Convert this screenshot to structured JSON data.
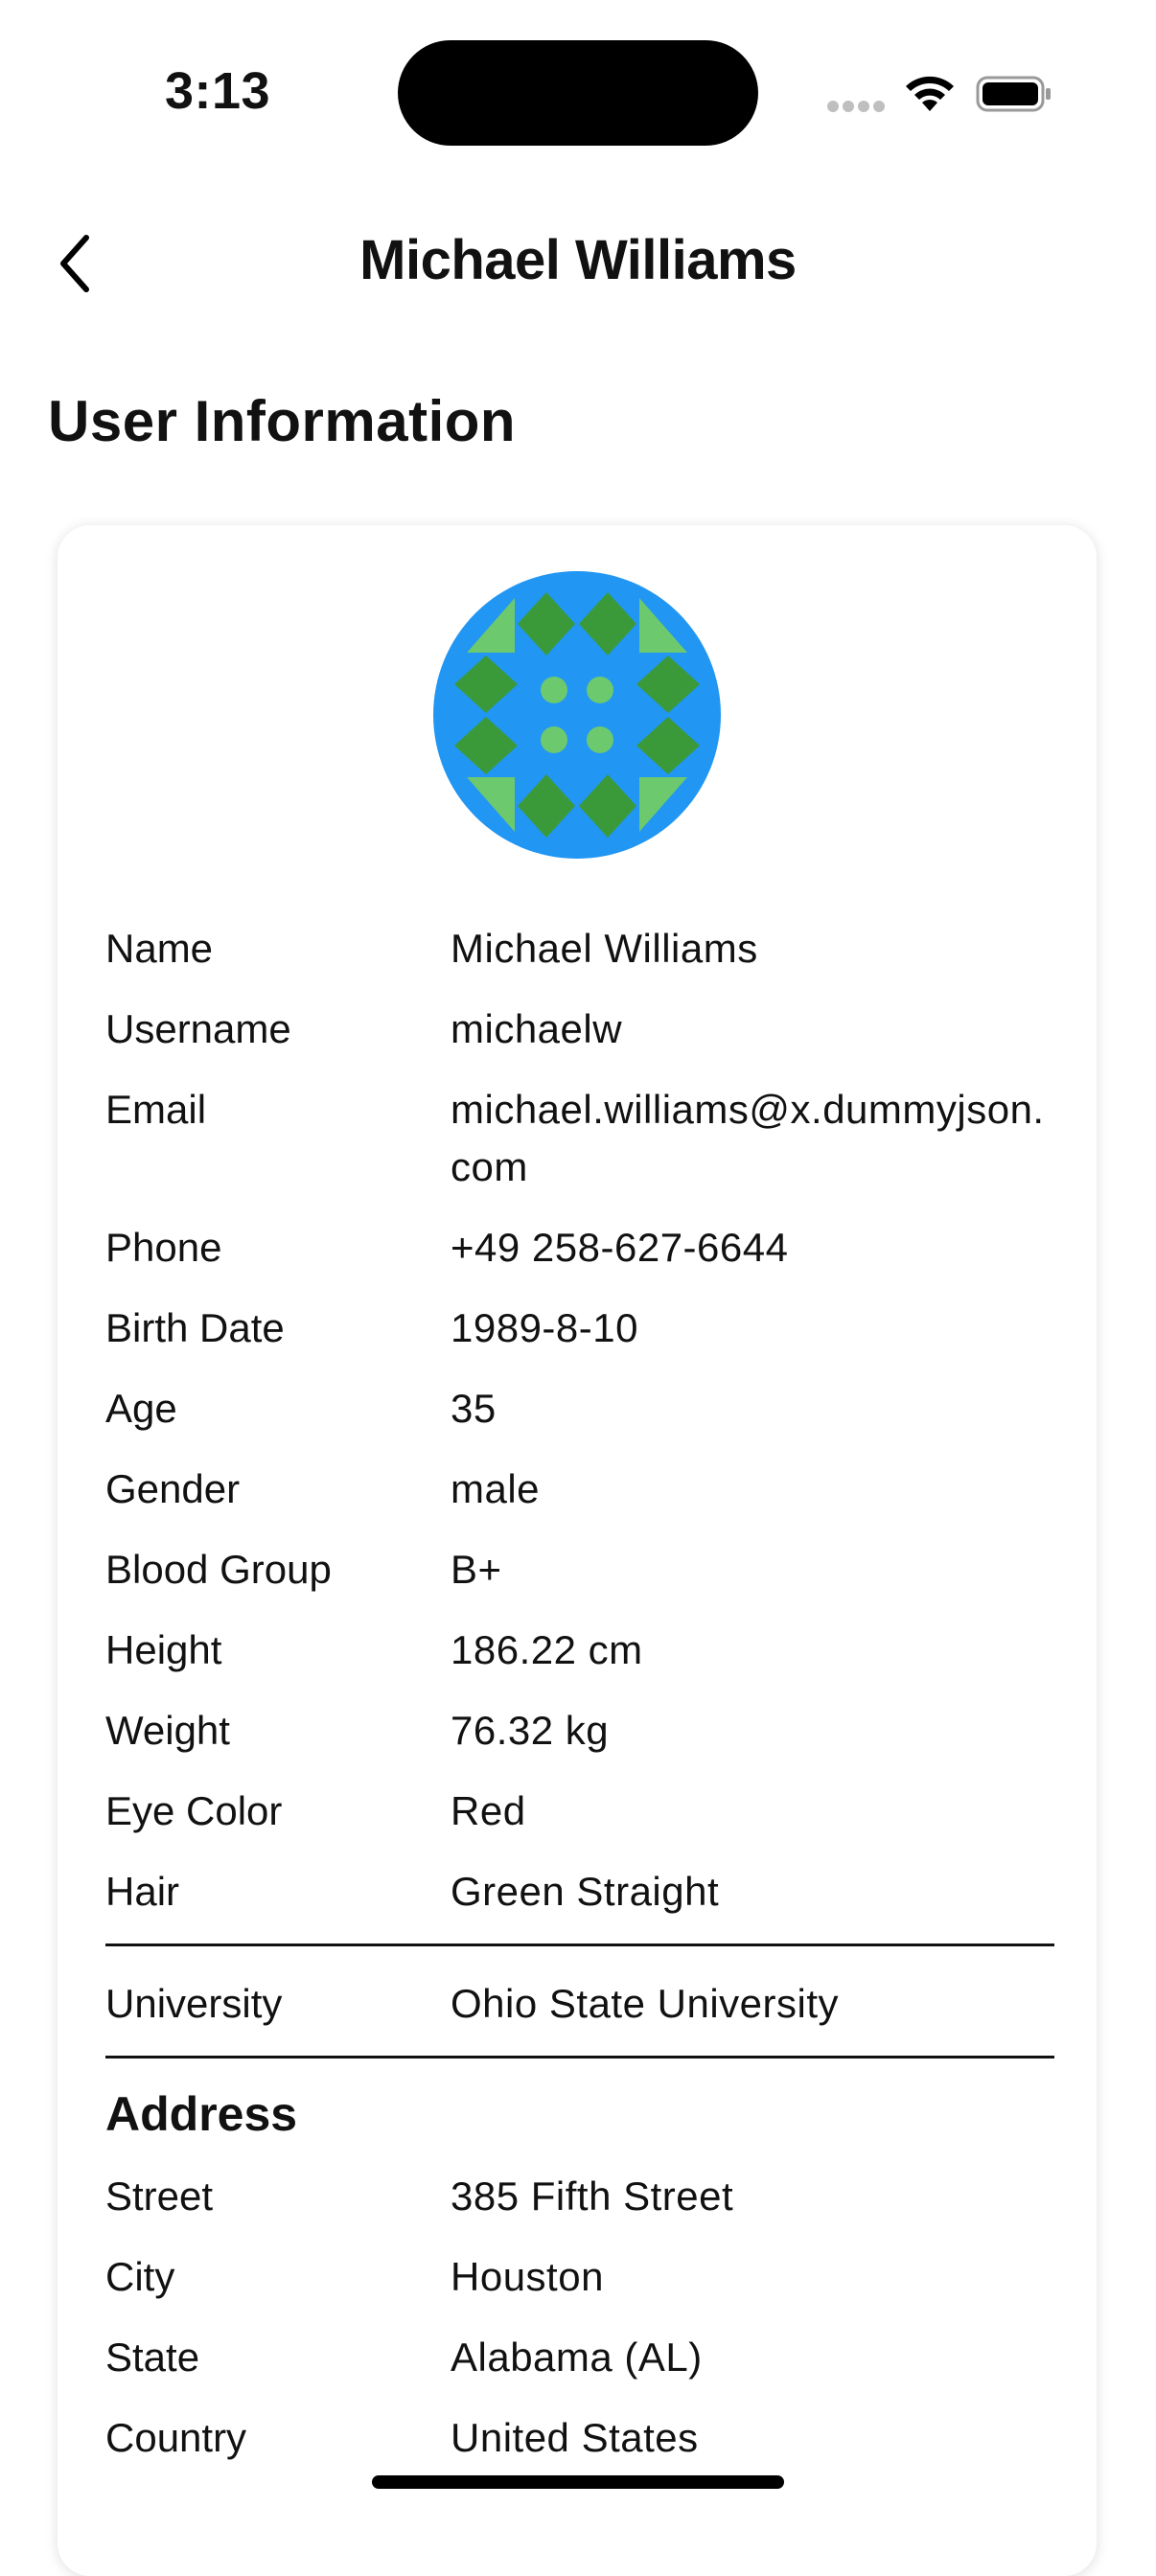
{
  "status_bar": {
    "time": "3:13"
  },
  "nav": {
    "title": "Michael Williams"
  },
  "section_title": "User Information",
  "colors": {
    "avatar_bg": "#2196F3",
    "avatar_dark": "#3A9A3A",
    "avatar_light": "#6DC96D"
  },
  "details": [
    {
      "label": "Name",
      "value": "Michael Williams"
    },
    {
      "label": "Username",
      "value": "michaelw"
    },
    {
      "label": "Email",
      "value": "michael.williams@x.dummyjson.com"
    },
    {
      "label": "Phone",
      "value": "+49 258-627-6644"
    },
    {
      "label": "Birth Date",
      "value": "1989-8-10"
    },
    {
      "label": "Age",
      "value": "35"
    },
    {
      "label": "Gender",
      "value": "male"
    },
    {
      "label": "Blood Group",
      "value": "B+"
    },
    {
      "label": "Height",
      "value": "186.22 cm"
    },
    {
      "label": "Weight",
      "value": "76.32 kg"
    },
    {
      "label": "Eye Color",
      "value": "Red"
    },
    {
      "label": "Hair",
      "value": "Green Straight"
    }
  ],
  "university": {
    "label": "University",
    "value": "Ohio State University"
  },
  "address": {
    "heading": "Address",
    "rows": [
      {
        "label": "Street",
        "value": "385 Fifth Street"
      },
      {
        "label": "City",
        "value": "Houston"
      },
      {
        "label": "State",
        "value": "Alabama (AL)"
      },
      {
        "label": "Country",
        "value": "United States"
      }
    ]
  }
}
